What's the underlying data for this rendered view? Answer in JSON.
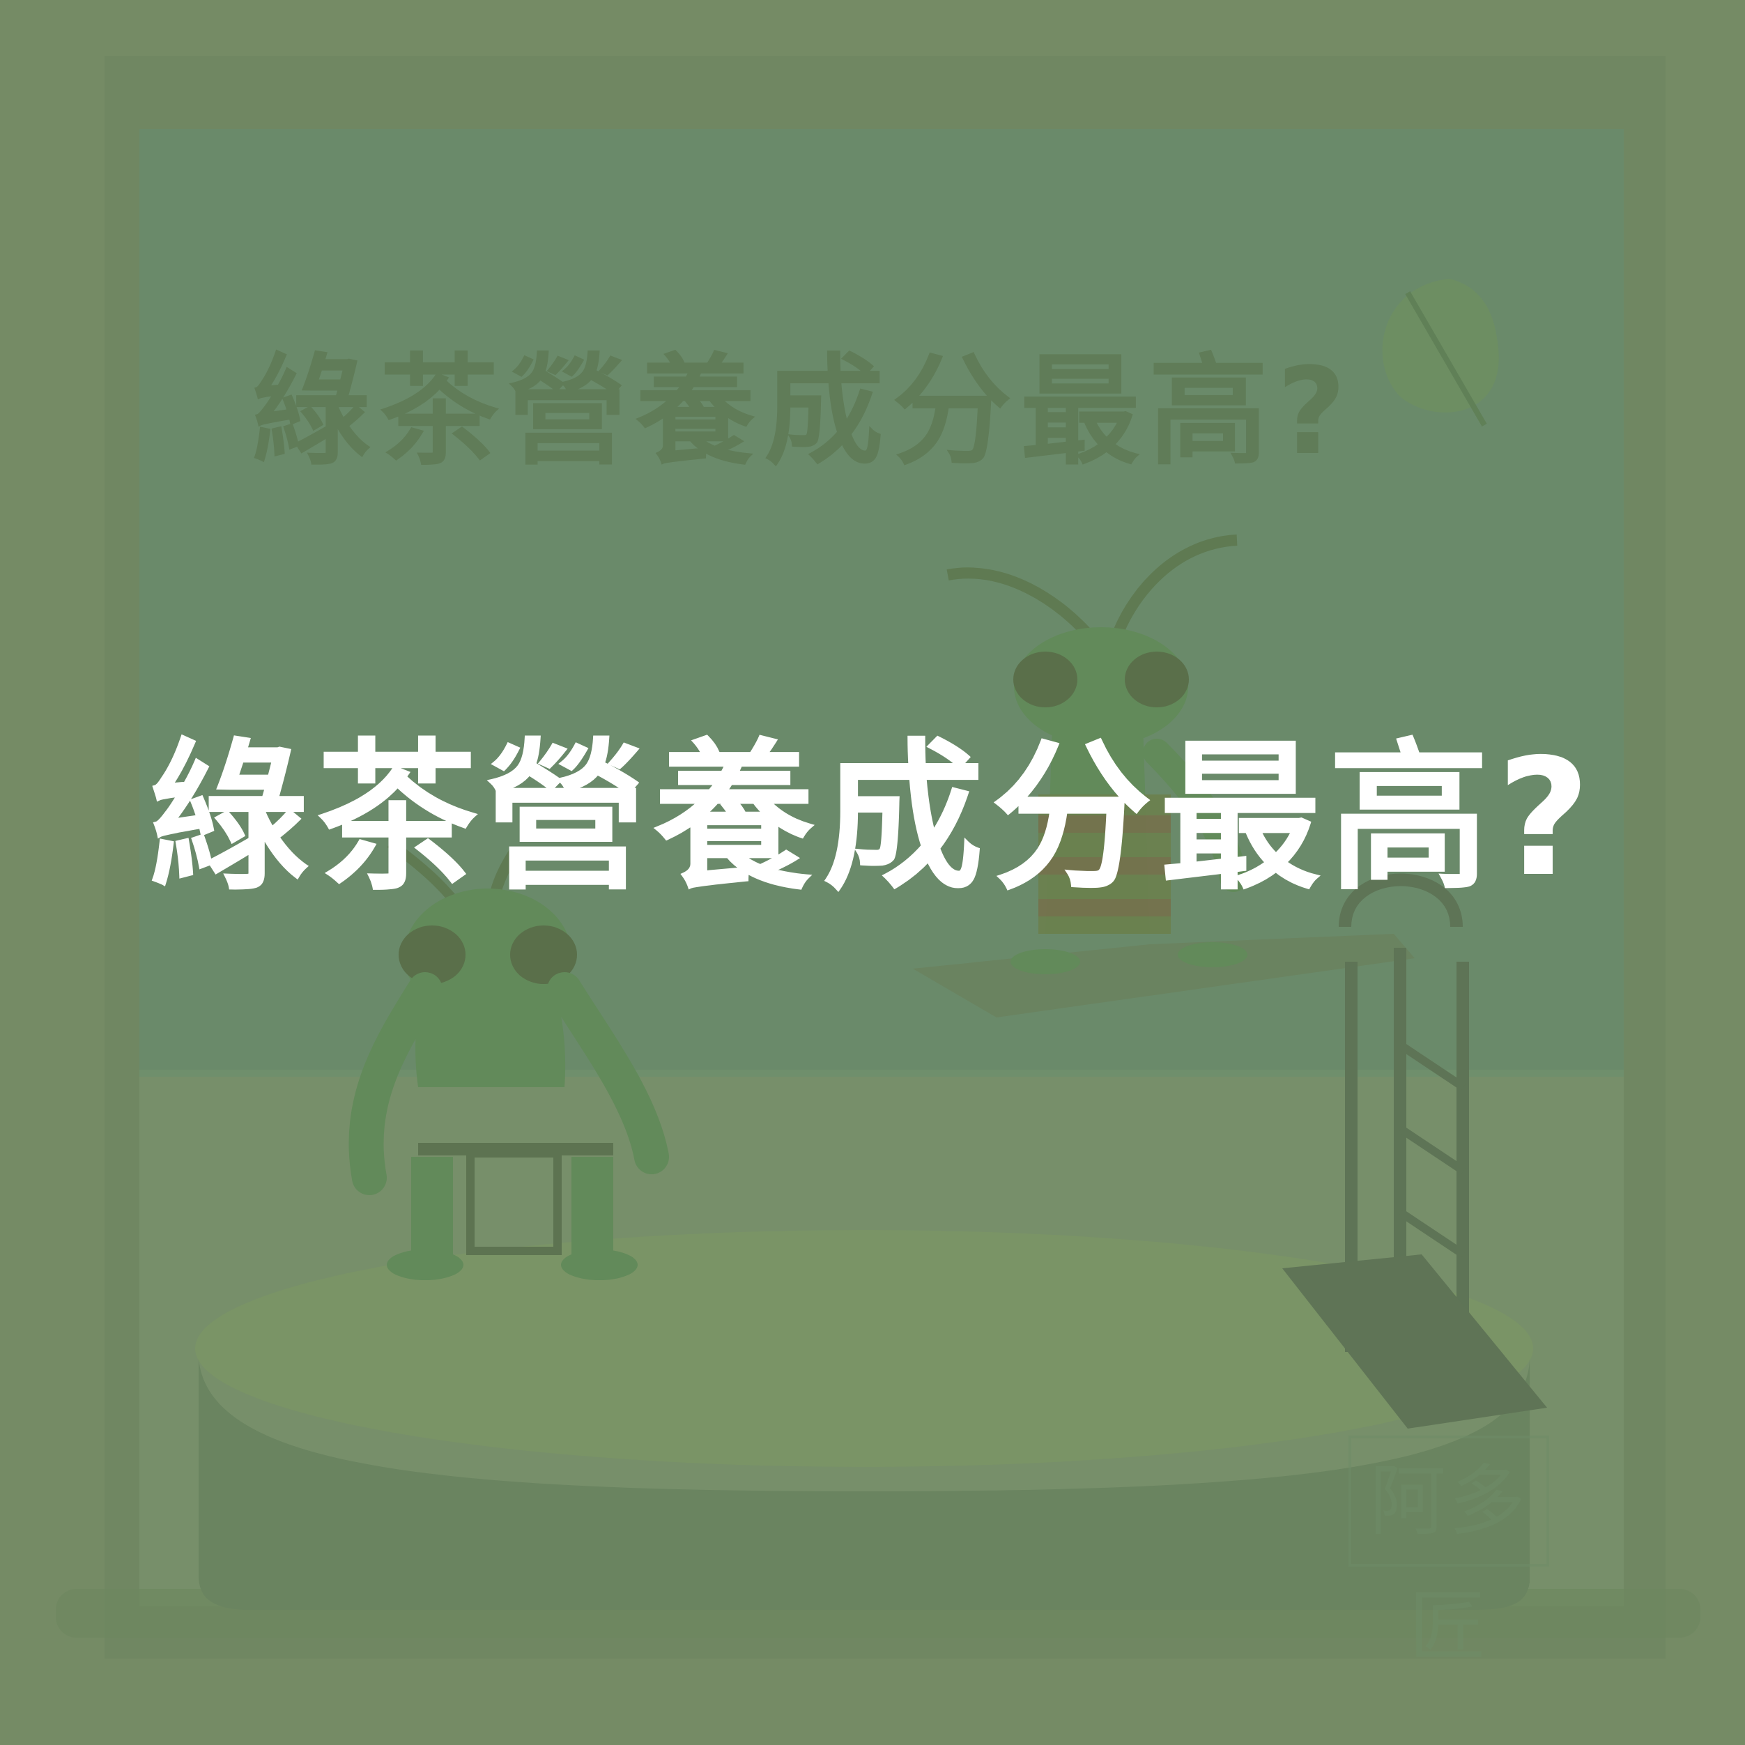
{
  "heading": {
    "text": "綠茶營養成分最高?"
  },
  "background_heading": {
    "text": "綠茶營養成分最高?"
  },
  "stamp": {
    "text": "阿多匠"
  },
  "colors": {
    "background": "#758b65",
    "window_glass": "#6a8a6a",
    "frame": "#6b8560",
    "character_green": "#628a5a",
    "dark_accent": "#5d7351",
    "heading_text": "#ffffff"
  },
  "icons": {
    "leaf": "leaf-icon"
  }
}
